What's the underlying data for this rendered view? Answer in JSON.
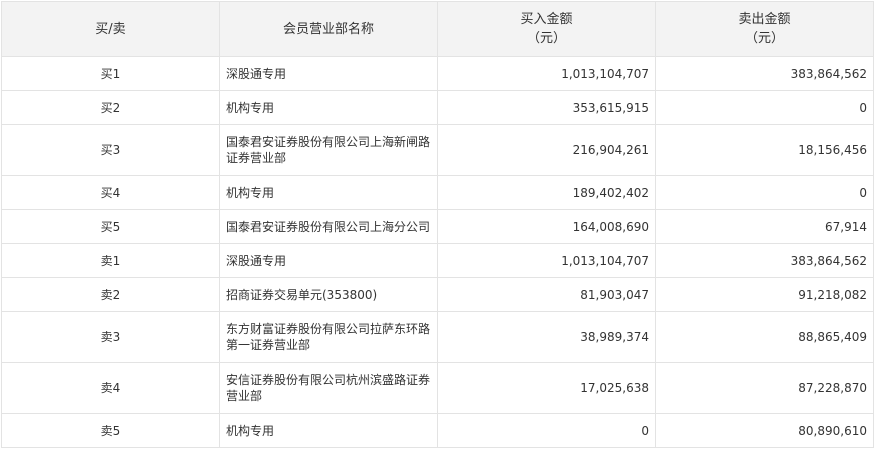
{
  "table": {
    "headers": {
      "side": "买/卖",
      "branch": "会员营业部名称",
      "buy_amount": [
        "买入金额",
        "（元）"
      ],
      "sell_amount": [
        "卖出金额",
        "（元）"
      ]
    },
    "rows": [
      {
        "side": "买1",
        "branch": [
          "深股通专用"
        ],
        "buy": "1,013,104,707",
        "sell": "383,864,562"
      },
      {
        "side": "买2",
        "branch": [
          "机构专用"
        ],
        "buy": "353,615,915",
        "sell": "0"
      },
      {
        "side": "买3",
        "branch": [
          "国泰君安证券股份有限公司上海新闸路",
          "证券营业部"
        ],
        "buy": "216,904,261",
        "sell": "18,156,456"
      },
      {
        "side": "买4",
        "branch": [
          "机构专用"
        ],
        "buy": "189,402,402",
        "sell": "0"
      },
      {
        "side": "买5",
        "branch": [
          "国泰君安证券股份有限公司上海分公司"
        ],
        "buy": "164,008,690",
        "sell": "67,914"
      },
      {
        "side": "卖1",
        "branch": [
          "深股通专用"
        ],
        "buy": "1,013,104,707",
        "sell": "383,864,562"
      },
      {
        "side": "卖2",
        "branch": [
          "招商证券交易单元(353800)"
        ],
        "buy": "81,903,047",
        "sell": "91,218,082"
      },
      {
        "side": "卖3",
        "branch": [
          "东方财富证券股份有限公司拉萨东环路",
          "第一证券营业部"
        ],
        "buy": "38,989,374",
        "sell": "88,865,409"
      },
      {
        "side": "卖4",
        "branch": [
          "安信证券股份有限公司杭州滨盛路证券",
          "营业部"
        ],
        "buy": "17,025,638",
        "sell": "87,228,870"
      },
      {
        "side": "卖5",
        "branch": [
          "机构专用"
        ],
        "buy": "0",
        "sell": "80,890,610"
      }
    ]
  }
}
